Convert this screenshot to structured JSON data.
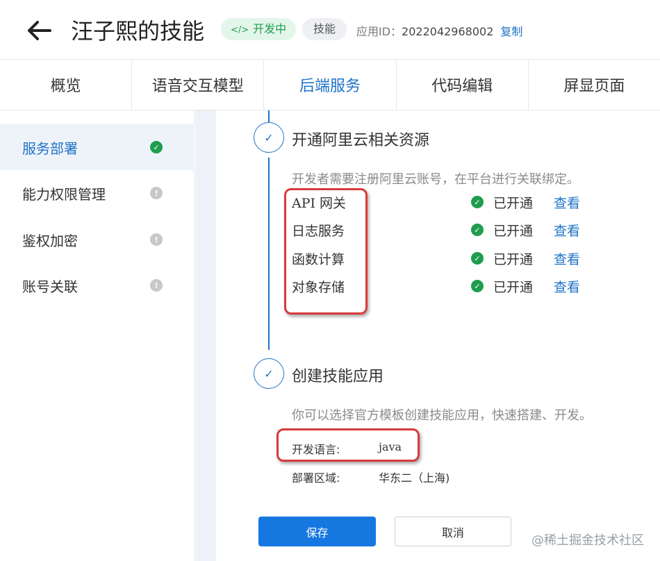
{
  "header": {
    "title": "汪子熙的技能",
    "status_badge": "开发中",
    "status_badge_icon": "</>",
    "type_badge": "技能",
    "app_id_label": "应用ID：",
    "app_id_value": "2022042968002",
    "copy_label": "复制"
  },
  "tabs": [
    {
      "label": "概览"
    },
    {
      "label": "语音交互模型"
    },
    {
      "label": "后端服务"
    },
    {
      "label": "代码编辑"
    },
    {
      "label": "屏显页面"
    }
  ],
  "sidebar": {
    "items": [
      {
        "label": "服务部署",
        "status": "done"
      },
      {
        "label": "能力权限管理",
        "status": "pending"
      },
      {
        "label": "鉴权加密",
        "status": "pending"
      },
      {
        "label": "账号关联",
        "status": "pending"
      }
    ]
  },
  "steps": {
    "step1": {
      "title": "开通阿里云相关资源",
      "description": "开发者需要注册阿里云账号，在平台进行关联绑定。",
      "resources": [
        {
          "name": "API 网关",
          "status": "已开通",
          "link": "查看"
        },
        {
          "name": "日志服务",
          "status": "已开通",
          "link": "查看"
        },
        {
          "name": "函数计算",
          "status": "已开通",
          "link": "查看"
        },
        {
          "name": "对象存储",
          "status": "已开通",
          "link": "查看"
        }
      ]
    },
    "step2": {
      "title": "创建技能应用",
      "description": "你可以选择官方模板创建技能应用，快速搭建、开发。",
      "language_label": "开发语言:",
      "language_value": "java",
      "region_label": "部署区域:",
      "region_value": "华东二（上海)"
    }
  },
  "actions": {
    "save_label": "保存",
    "cancel_label": "取消"
  },
  "watermark": "@稀土掘金技术社区",
  "colors": {
    "accent": "#1f73c8",
    "success": "#1f9d4f",
    "highlight": "#d83a3a",
    "primary_button": "#1677e0"
  }
}
